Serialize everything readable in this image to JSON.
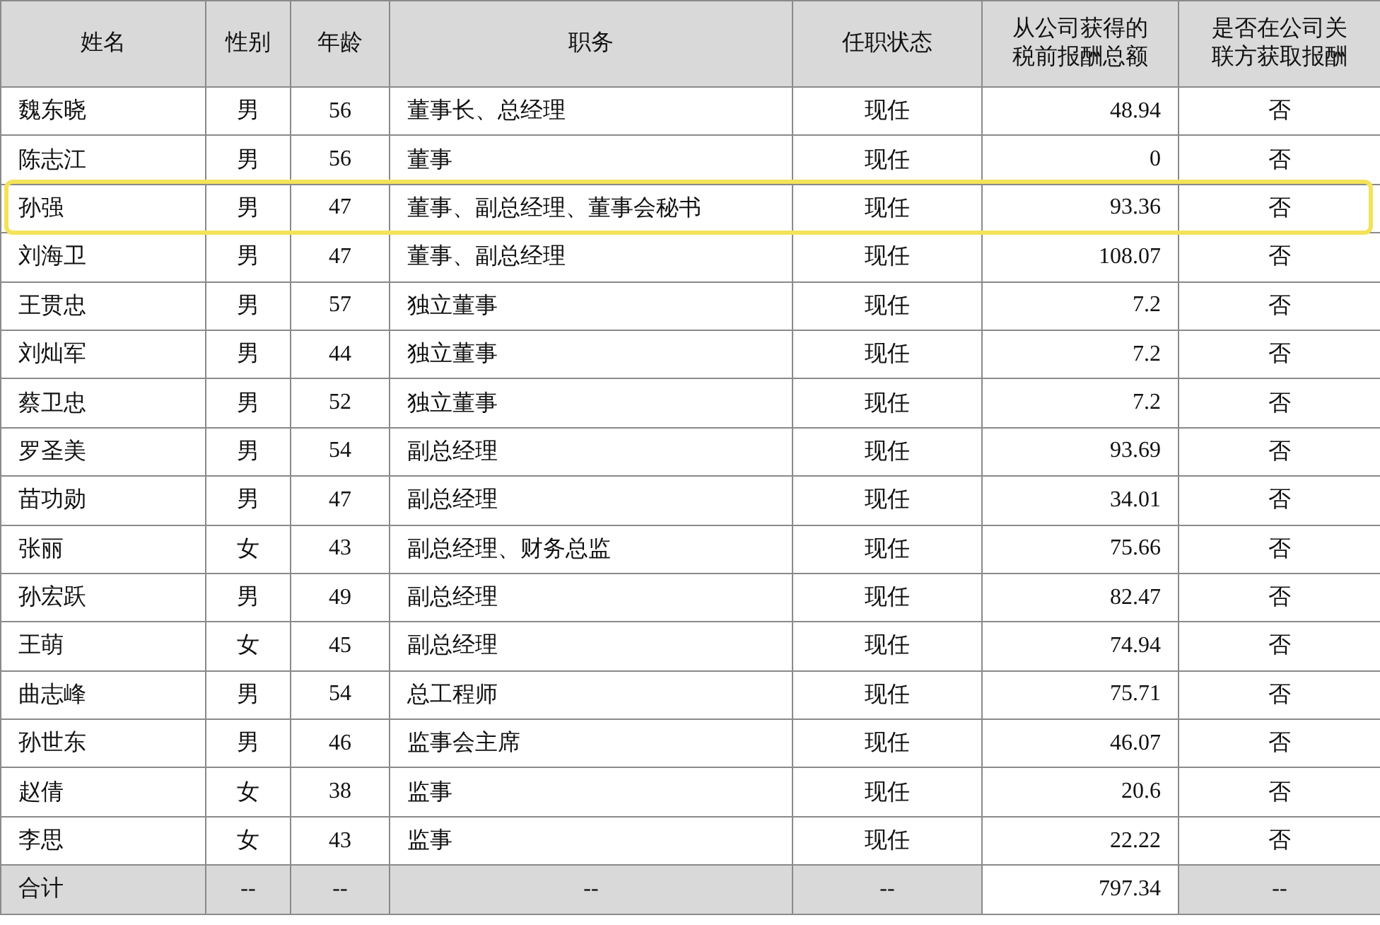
{
  "table": {
    "columns": [
      "姓名",
      "性别",
      "年龄",
      "职务",
      "任职状态",
      "从公司获得的税前报酬总额",
      "是否在公司关联方获取报酬"
    ],
    "rows": [
      {
        "name": "魏东晓",
        "gender": "男",
        "age": "56",
        "position": "董事长、总经理",
        "status": "现任",
        "pay": "48.94",
        "related_pay": "否",
        "highlighted": false
      },
      {
        "name": "陈志江",
        "gender": "男",
        "age": "56",
        "position": "董事",
        "status": "现任",
        "pay": "0",
        "related_pay": "否",
        "highlighted": false
      },
      {
        "name": "孙强",
        "gender": "男",
        "age": "47",
        "position": "董事、副总经理、董事会秘书",
        "status": "现任",
        "pay": "93.36",
        "related_pay": "否",
        "highlighted": true
      },
      {
        "name": "刘海卫",
        "gender": "男",
        "age": "47",
        "position": "董事、副总经理",
        "status": "现任",
        "pay": "108.07",
        "related_pay": "否",
        "highlighted": false
      },
      {
        "name": "王贯忠",
        "gender": "男",
        "age": "57",
        "position": "独立董事",
        "status": "现任",
        "pay": "7.2",
        "related_pay": "否",
        "highlighted": false
      },
      {
        "name": "刘灿军",
        "gender": "男",
        "age": "44",
        "position": "独立董事",
        "status": "现任",
        "pay": "7.2",
        "related_pay": "否",
        "highlighted": false
      },
      {
        "name": "蔡卫忠",
        "gender": "男",
        "age": "52",
        "position": "独立董事",
        "status": "现任",
        "pay": "7.2",
        "related_pay": "否",
        "highlighted": false
      },
      {
        "name": "罗圣美",
        "gender": "男",
        "age": "54",
        "position": "副总经理",
        "status": "现任",
        "pay": "93.69",
        "related_pay": "否",
        "highlighted": false
      },
      {
        "name": "苗功勋",
        "gender": "男",
        "age": "47",
        "position": "副总经理",
        "status": "现任",
        "pay": "34.01",
        "related_pay": "否",
        "highlighted": false
      },
      {
        "name": "张丽",
        "gender": "女",
        "age": "43",
        "position": "副总经理、财务总监",
        "status": "现任",
        "pay": "75.66",
        "related_pay": "否",
        "highlighted": false
      },
      {
        "name": "孙宏跃",
        "gender": "男",
        "age": "49",
        "position": "副总经理",
        "status": "现任",
        "pay": "82.47",
        "related_pay": "否",
        "highlighted": false
      },
      {
        "name": "王萌",
        "gender": "女",
        "age": "45",
        "position": "副总经理",
        "status": "现任",
        "pay": "74.94",
        "related_pay": "否",
        "highlighted": false
      },
      {
        "name": "曲志峰",
        "gender": "男",
        "age": "54",
        "position": "总工程师",
        "status": "现任",
        "pay": "75.71",
        "related_pay": "否",
        "highlighted": false
      },
      {
        "name": "孙世东",
        "gender": "男",
        "age": "46",
        "position": "监事会主席",
        "status": "现任",
        "pay": "46.07",
        "related_pay": "否",
        "highlighted": false
      },
      {
        "name": "赵倩",
        "gender": "女",
        "age": "38",
        "position": "监事",
        "status": "现任",
        "pay": "20.6",
        "related_pay": "否",
        "highlighted": false
      },
      {
        "name": "李思",
        "gender": "女",
        "age": "43",
        "position": "监事",
        "status": "现任",
        "pay": "22.22",
        "related_pay": "否",
        "highlighted": false
      }
    ],
    "total": {
      "name": "合计",
      "gender": "--",
      "age": "--",
      "position": "--",
      "status": "--",
      "pay": "797.34",
      "related_pay": "--"
    }
  }
}
